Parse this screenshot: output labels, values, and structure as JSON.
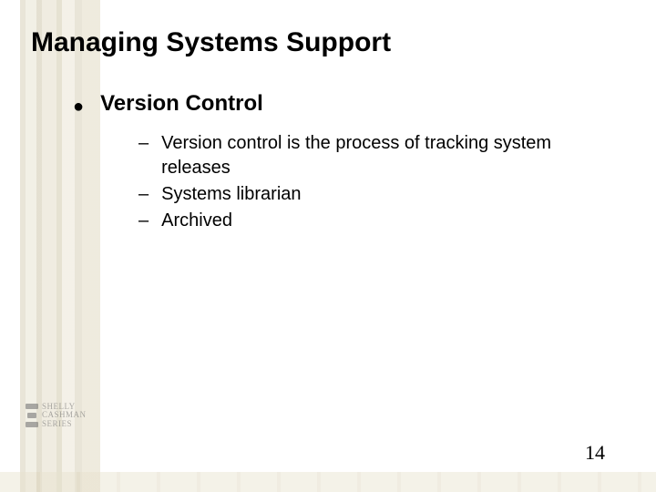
{
  "slide": {
    "title": "Managing Systems Support",
    "bullet": {
      "label": "Version Control",
      "subitems": [
        "Version control is the process of tracking system releases",
        "Systems librarian",
        "Archived"
      ]
    },
    "page_number": "14",
    "logo": {
      "line1": "Shelly",
      "line2": "Cashman",
      "line3": "Series"
    }
  }
}
